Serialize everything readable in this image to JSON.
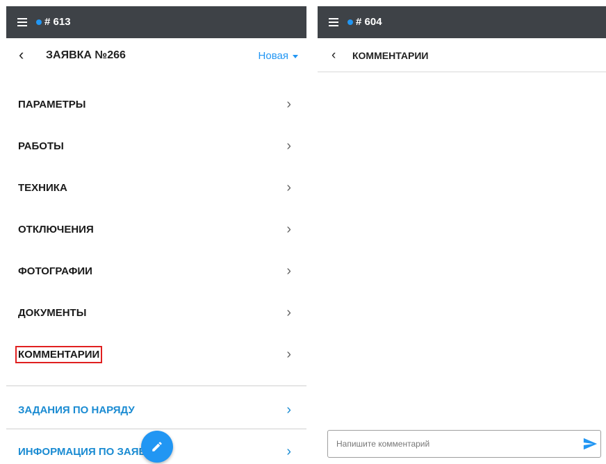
{
  "left": {
    "ticket_number": "# 613",
    "title": "ЗАЯВКА №266",
    "status": "Новая",
    "items": [
      {
        "label": "ПАРАМЕТРЫ"
      },
      {
        "label": "РАБОТЫ"
      },
      {
        "label": "ТЕХНИКА"
      },
      {
        "label": "ОТКЛЮЧЕНИЯ"
      },
      {
        "label": "ФОТОГРАФИИ"
      },
      {
        "label": "ДОКУМЕНТЫ"
      },
      {
        "label": "КОММЕНТАРИИ"
      }
    ],
    "links": [
      {
        "label": "ЗАДАНИЯ ПО НАРЯДУ"
      },
      {
        "label": "ИНФОРМАЦИЯ ПО ЗАЯВ"
      }
    ]
  },
  "right": {
    "ticket_number": "# 604",
    "title": "КОММЕНТАРИИ",
    "comment_placeholder": "Напишите комментарий"
  },
  "colors": {
    "topbar": "#3e4247",
    "accent": "#2196f3",
    "link": "#1a8bd2",
    "highlight": "#e02020"
  },
  "icons": [
    "hamburger-icon",
    "status-dot-icon",
    "back-arrow-icon",
    "chevron-right-icon",
    "edit-pencil-icon",
    "send-icon",
    "caret-down-icon"
  ]
}
